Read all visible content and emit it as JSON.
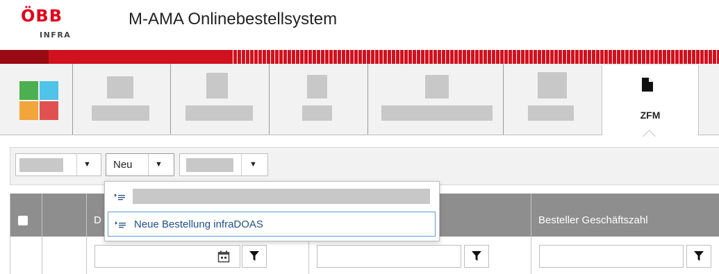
{
  "header": {
    "logo_top": "ÖBB",
    "logo_bottom": "INFRA",
    "title": "M-AMA Onlinebestellsystem"
  },
  "colors": {
    "brand_red": "#d2111e",
    "active_tab_bg": "#ffffff",
    "grid_header_bg": "#8e8e8e",
    "menu_item_text": "#1f4e8a",
    "menu_focus_border": "#5d9cd8",
    "tile_green": "#4caf50",
    "tile_blue": "#4fc3e8",
    "tile_orange": "#f2a53b",
    "tile_red": "#e05252"
  },
  "nav": {
    "home_icon": "app-grid-icon",
    "active": {
      "label": "ZFM",
      "icon": "document-icon"
    }
  },
  "toolbar": {
    "neu_label": "Neu",
    "arrow_glyph": "▼"
  },
  "menu": {
    "item_icon": "list-indent-icon",
    "item2_label": "Neue Bestellung infraDOAS"
  },
  "grid": {
    "col1_header_fragment": "D",
    "col3_header": "Besteller Geschäftszahl",
    "calendar_icon": "calendar-icon",
    "filter_icon": "filter-icon"
  }
}
